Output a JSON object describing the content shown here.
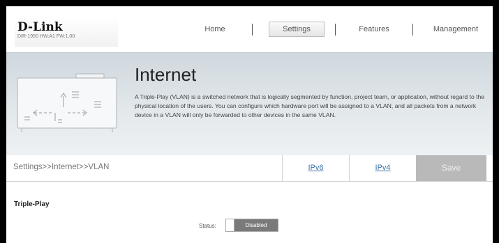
{
  "header": {
    "logo_text": "D-Link",
    "model_info": "DIR-1950 HW:A1 FW:1.00",
    "nav": [
      {
        "label": "Home",
        "active": false
      },
      {
        "label": "Settings",
        "active": true
      },
      {
        "label": "Features",
        "active": false
      },
      {
        "label": "Management",
        "active": false
      }
    ]
  },
  "banner": {
    "title": "Internet",
    "description": "A Triple-Play (VLAN) is a switched network that is logically segmented by function, project team, or application, without regard to the physical location of the users. You can configure which hardware port will be assigned to a VLAN, and all packets from a network device in a VLAN will only be forwarded to other devices in the same VLAN.",
    "icon": "network-ports-icon"
  },
  "toolbar": {
    "breadcrumb": "Settings>>Internet>>VLAN",
    "ipv6_label": "IPv6",
    "ipv4_label": "IPv4",
    "save_label": "Save"
  },
  "section": {
    "title": "Triple-Play",
    "status_label": "Status:",
    "status_value": "Disabled"
  },
  "colors": {
    "accent_link": "#3a6fa8",
    "save_disabled": "#b9b9b9",
    "toggle_off": "#7a7a7a"
  }
}
